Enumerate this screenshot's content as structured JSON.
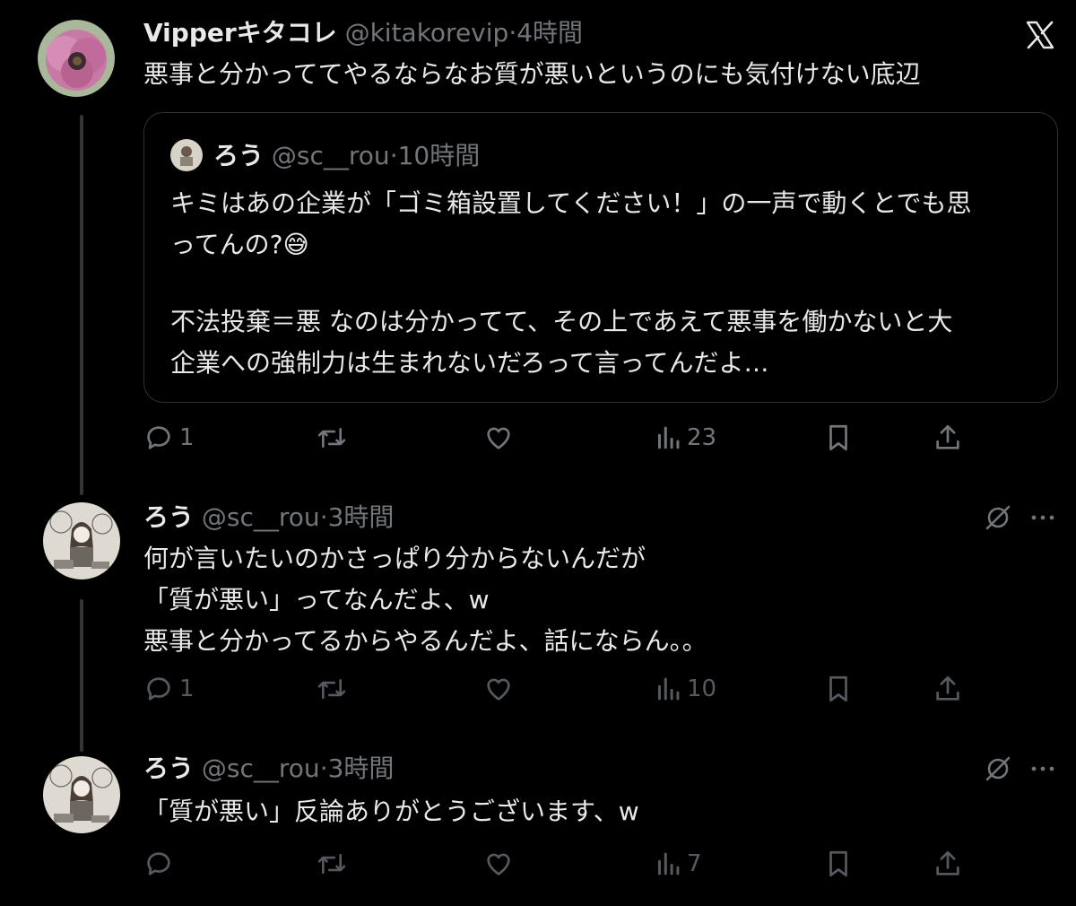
{
  "main_post": {
    "display_name": "Vipperキタコレ",
    "handle": "@kitakorevip",
    "time": "4時間",
    "text": "悪事と分かっててやるならなお質が悪いというのにも気付けない底辺",
    "quote": {
      "display_name": "ろう",
      "handle": "@sc__rou",
      "time": "10時間",
      "lines": [
        "キミはあの企業が「ゴミ箱設置してください！」の一声で動くとでも思",
        "ってんの?😅",
        "",
        "不法投棄＝悪 なのは分かってて、その上であえて悪事を働かないと大",
        "企業への強制力は生まれないだろって言ってんだよ…"
      ]
    },
    "reply_count": "1",
    "view_count": "23"
  },
  "replies": [
    {
      "display_name": "ろう",
      "handle": "@sc__rou",
      "time": "3時間",
      "lines": [
        "何が言いたいのかさっぱり分からないんだが",
        "「質が悪い」ってなんだよ、w",
        "悪事と分かってるからやるんだよ、話にならん。。"
      ],
      "reply_count": "1",
      "view_count": "10"
    },
    {
      "display_name": "ろう",
      "handle": "@sc__rou",
      "time": "3時間",
      "lines": [
        "「質が悪い」反論ありがとうございます、w"
      ],
      "reply_count": "",
      "view_count": "7"
    }
  ],
  "separator": "·",
  "icons": [
    "x-logo-icon",
    "reply-icon",
    "repost-icon",
    "like-icon",
    "views-icon",
    "bookmark-icon",
    "share-icon",
    "grok-icon",
    "more-icon"
  ],
  "colors": {
    "background": "#000000",
    "text": "#e7e9ea",
    "secondary": "#71767b",
    "border": "#2f3336"
  }
}
